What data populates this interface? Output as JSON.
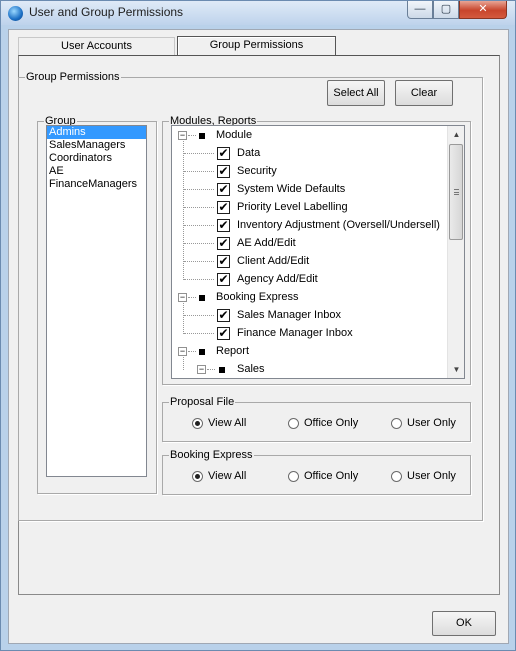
{
  "window": {
    "title": "User and Group Permissions",
    "minimize_glyph": "—",
    "maximize_glyph": "▢",
    "close_glyph": "✕"
  },
  "tabs": [
    {
      "label": "User Accounts",
      "active": false
    },
    {
      "label": "Group Permissions",
      "active": true
    }
  ],
  "group_permissions": {
    "legend": "Group Permissions",
    "select_all_label": "Select All",
    "clear_label": "Clear"
  },
  "group_list": {
    "legend": "Group",
    "items": [
      "Admins",
      "SalesManagers",
      "Coordinators",
      "AE",
      "FinanceManagers"
    ],
    "selected": "Admins"
  },
  "modules_tree": {
    "legend": "Modules, Reports",
    "nodes": [
      {
        "label": "Module",
        "level": 0,
        "checkable": false,
        "expanded": true
      },
      {
        "label": "Data",
        "level": 1,
        "checkable": true,
        "checked": true
      },
      {
        "label": "Security",
        "level": 1,
        "checkable": true,
        "checked": true
      },
      {
        "label": "System Wide Defaults",
        "level": 1,
        "checkable": true,
        "checked": true
      },
      {
        "label": "Priority Level Labelling",
        "level": 1,
        "checkable": true,
        "checked": true
      },
      {
        "label": "Inventory Adjustment (Oversell/Undersell)",
        "level": 1,
        "checkable": true,
        "checked": true
      },
      {
        "label": "AE Add/Edit",
        "level": 1,
        "checkable": true,
        "checked": true
      },
      {
        "label": "Client Add/Edit",
        "level": 1,
        "checkable": true,
        "checked": true
      },
      {
        "label": "Agency Add/Edit",
        "level": 1,
        "checkable": true,
        "checked": true
      },
      {
        "label": "Booking Express",
        "level": 0,
        "checkable": false,
        "expanded": true
      },
      {
        "label": "Sales Manager Inbox",
        "level": 1,
        "checkable": true,
        "checked": true
      },
      {
        "label": "Finance Manager Inbox",
        "level": 1,
        "checkable": true,
        "checked": true
      },
      {
        "label": "Report",
        "level": 0,
        "checkable": false,
        "expanded": true
      },
      {
        "label": "Sales",
        "level": 1,
        "checkable": false,
        "expanded": true
      }
    ],
    "check_glyph": "✔",
    "expanded_glyph": "−"
  },
  "proposal_file": {
    "legend": "Proposal File",
    "options": [
      "View All",
      "Office Only",
      "User Only"
    ],
    "selected": "View All"
  },
  "booking_express": {
    "legend": "Booking Express",
    "options": [
      "View All",
      "Office Only",
      "User Only"
    ],
    "selected": "View All"
  },
  "footer": {
    "ok_label": "OK"
  },
  "scrollbar": {
    "up_glyph": "▲",
    "down_glyph": "▼"
  }
}
